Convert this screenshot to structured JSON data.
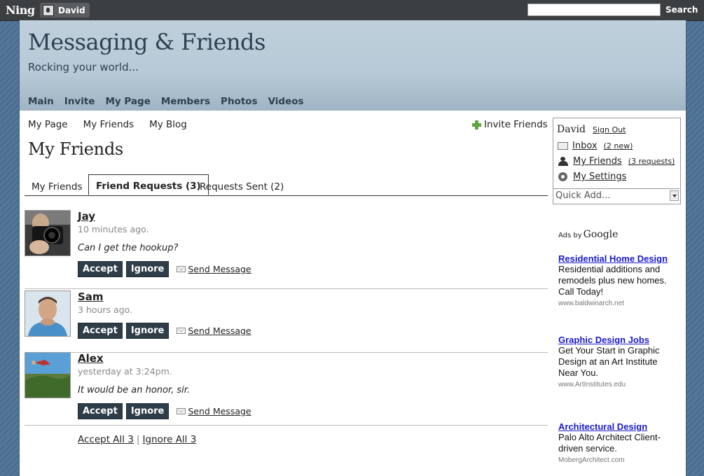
{
  "topbar": {
    "logo": "Ning",
    "user": "David",
    "search_placeholder": "",
    "search_label": "Search"
  },
  "header": {
    "title": "Messaging & Friends",
    "tagline": "Rocking your world...",
    "nav": [
      "Main",
      "Invite",
      "My Page",
      "Members",
      "Photos",
      "Videos"
    ]
  },
  "subnav": [
    "My Page",
    "My Friends",
    "My Blog"
  ],
  "invite_friends": "Invite Friends",
  "page_title": "My Friends",
  "tabs": [
    "My Friends",
    "Friend Requests (3)",
    "Requests Sent (2)"
  ],
  "active_tab": "Friend Requests (3)",
  "requests": [
    {
      "name": "Jay",
      "time": "10 minutes ago.",
      "message": "Can I get the hookup?",
      "accept": "Accept",
      "ignore": "Ignore",
      "send": "Send Message"
    },
    {
      "name": "Sam",
      "time": "3 hours ago.",
      "message": "",
      "accept": "Accept",
      "ignore": "Ignore",
      "send": "Send Message"
    },
    {
      "name": "Alex",
      "time": "yesterday at 3:24pm.",
      "message": "It would be an honor, sir.",
      "accept": "Accept",
      "ignore": "Ignore",
      "send": "Send Message"
    }
  ],
  "bulk": {
    "accept_all": "Accept All 3",
    "separator": "|",
    "ignore_all": "Ignore All 3"
  },
  "sidebar": {
    "name": "David",
    "sign_out": "Sign Out",
    "inbox": "Inbox",
    "inbox_count": "(2 new)",
    "friends": "My Friends",
    "friends_count": "(3 requests)",
    "settings": "My Settings",
    "quick_add": "Quick Add..."
  },
  "ads": {
    "label": "Ads by",
    "brand": "Google",
    "items": [
      {
        "title": "Residential Home Design",
        "body": "Residential additions and remodels plus new homes. Call Today!",
        "url": "www.baldwinarch.net"
      },
      {
        "title": "Graphic Design Jobs",
        "body": "Get Your Start in Graphic Design at an Art Institute Near You.",
        "url": "www.ArtInstitutes.edu"
      },
      {
        "title": "Architectural Design",
        "body": "Palo Alto Architect Client-driven service.",
        "url": "MobergArchitect.com"
      }
    ]
  }
}
